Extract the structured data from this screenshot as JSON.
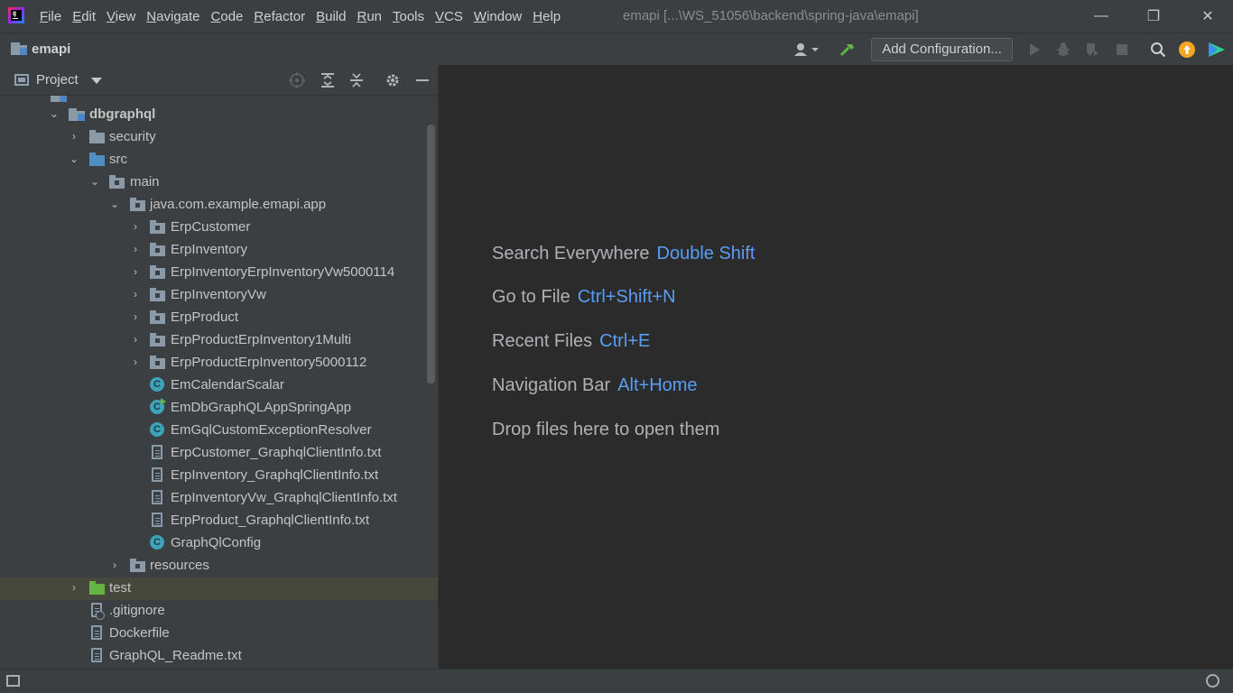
{
  "titlebar": {
    "menu": [
      "File",
      "Edit",
      "View",
      "Navigate",
      "Code",
      "Refactor",
      "Build",
      "Run",
      "Tools",
      "VCS",
      "Window",
      "Help"
    ],
    "window_title": "emapi [...\\WS_51056\\backend\\spring-java\\emapi]",
    "minimize": "—",
    "restore": "❐",
    "close": "✕"
  },
  "navbar": {
    "project_name": "emapi",
    "add_configuration": "Add Configuration..."
  },
  "project_panel": {
    "title": "Project",
    "tree": {
      "dbgraphql": "dbgraphql",
      "security": "security",
      "src": "src",
      "main": "main",
      "package": "java.com.example.emapi.app",
      "pkg_items": [
        "ErpCustomer",
        "ErpInventory",
        "ErpInventoryErpInventoryVw5000114",
        "ErpInventoryVw",
        "ErpProduct",
        "ErpProductErpInventory1Multi",
        "ErpProductErpInventory5000112"
      ],
      "classes": [
        "EmCalendarScalar",
        "EmDbGraphQLAppSpringApp",
        "EmGqlCustomExceptionResolver"
      ],
      "txt_files": [
        "ErpCustomer_GraphqlClientInfo.txt",
        "ErpInventory_GraphqlClientInfo.txt",
        "ErpInventoryVw_GraphqlClientInfo.txt",
        "ErpProduct_GraphqlClientInfo.txt"
      ],
      "graphql_config": "GraphQlConfig",
      "resources": "resources",
      "test": "test",
      "gitignore": ".gitignore",
      "dockerfile": "Dockerfile",
      "readme": "GraphQL_Readme.txt"
    }
  },
  "editor": {
    "hints": [
      {
        "label": "Search Everywhere",
        "key": "Double Shift"
      },
      {
        "label": "Go to File",
        "key": "Ctrl+Shift+N"
      },
      {
        "label": "Recent Files",
        "key": "Ctrl+E"
      },
      {
        "label": "Navigation Bar",
        "key": "Alt+Home"
      }
    ],
    "drop_text": "Drop files here to open them"
  },
  "colors": {
    "accent_key": "#589df6",
    "background": "#2b2b2b",
    "panel": "#3c3f41",
    "selected_row": "#45483a"
  }
}
